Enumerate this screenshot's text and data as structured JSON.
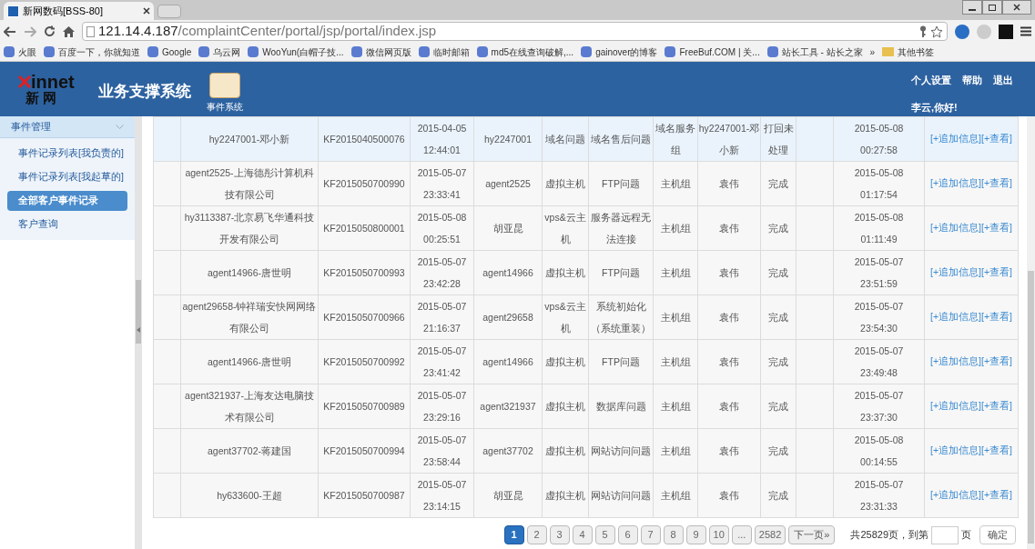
{
  "browser": {
    "tabs": [
      {
        "title": "新网数码[BSS-80]",
        "selected": true
      }
    ],
    "address": {
      "host": "121.14.4.187",
      "path": "/complaintCenter/portal/jsp/portal/index.jsp"
    },
    "bookmarks": [
      {
        "label": "火眼"
      },
      {
        "label": "百度一下，你就知道"
      },
      {
        "label": "Google"
      },
      {
        "label": "乌云网"
      },
      {
        "label": "WooYun(白帽子技..."
      },
      {
        "label": "微信网页版"
      },
      {
        "label": "临时邮箱"
      },
      {
        "label": "md5在线查询破解,..."
      },
      {
        "label": "gainover的博客"
      },
      {
        "label": "FreeBuf.COM | 关..."
      },
      {
        "label": "站长工具 - 站长之家"
      }
    ],
    "more": "»",
    "other_bookmarks": "其他书签"
  },
  "header": {
    "logo_wordmark": "innet",
    "logo_chinese": "新 网",
    "system_title": "业务支撑系统",
    "module": "事件系统",
    "links": [
      "个人设置",
      "帮助",
      "退出"
    ],
    "greeting": "李云,你好!"
  },
  "sidebar": {
    "section": "事件管理",
    "items": [
      {
        "label": "事件记录列表[我负责的]",
        "selected": false
      },
      {
        "label": "事件记录列表[我起草的]",
        "selected": false
      },
      {
        "label": "全部客户事件记录",
        "selected": true
      },
      {
        "label": "客户查询",
        "selected": false
      }
    ]
  },
  "table": {
    "rows": [
      {
        "selected": true,
        "cells": [
          "hy2247001-邓小新",
          "KF2015040500076",
          "2015-04-05 12:44:01",
          "hy2247001",
          "域名问题",
          "域名售后问题",
          "域名服务组",
          "hy2247001-邓小新",
          "打回未处理",
          "2015-05-08 00:27:58"
        ],
        "actions": [
          "[+追加信息]",
          "[+查看]"
        ]
      },
      {
        "selected": false,
        "cells": [
          "agent2525-上海德彤计算机科技有限公司",
          "KF2015050700990",
          "2015-05-07 23:33:41",
          "agent2525",
          "虚拟主机",
          "FTP问题",
          "主机组",
          "袁伟",
          "完成",
          "2015-05-08 01:17:54"
        ],
        "actions": [
          "[+追加信息]",
          "[+查看]"
        ]
      },
      {
        "selected": false,
        "cells": [
          "hy3113387-北京易飞华通科技开发有限公司",
          "KF2015050800001",
          "2015-05-08 00:25:51",
          "胡亚昆",
          "vps&云主机",
          "服务器远程无法连接",
          "主机组",
          "袁伟",
          "完成",
          "2015-05-08 01:11:49"
        ],
        "actions": [
          "[+追加信息]",
          "[+查看]"
        ]
      },
      {
        "selected": false,
        "cells": [
          "agent14966-唐世明",
          "KF2015050700993",
          "2015-05-07 23:42:28",
          "agent14966",
          "虚拟主机",
          "FTP问题",
          "主机组",
          "袁伟",
          "完成",
          "2015-05-07 23:51:59"
        ],
        "actions": [
          "[+追加信息]",
          "[+查看]"
        ]
      },
      {
        "selected": false,
        "cells": [
          "agent29658-钟祥瑞安快网网络有限公司",
          "KF2015050700966",
          "2015-05-07 21:16:37",
          "agent29658",
          "vps&云主机",
          "系统初始化（系统重装）",
          "主机组",
          "袁伟",
          "完成",
          "2015-05-07 23:54:30"
        ],
        "actions": [
          "[+追加信息]",
          "[+查看]"
        ]
      },
      {
        "selected": false,
        "cells": [
          "agent14966-唐世明",
          "KF2015050700992",
          "2015-05-07 23:41:42",
          "agent14966",
          "虚拟主机",
          "FTP问题",
          "主机组",
          "袁伟",
          "完成",
          "2015-05-07 23:49:48"
        ],
        "actions": [
          "[+追加信息]",
          "[+查看]"
        ]
      },
      {
        "selected": false,
        "cells": [
          "agent321937-上海友达电脑技术有限公司",
          "KF2015050700989",
          "2015-05-07 23:29:16",
          "agent321937",
          "虚拟主机",
          "数据库问题",
          "主机组",
          "袁伟",
          "完成",
          "2015-05-07 23:37:30"
        ],
        "actions": [
          "[+追加信息]",
          "[+查看]"
        ]
      },
      {
        "selected": false,
        "cells": [
          "agent37702-蒋建国",
          "KF2015050700994",
          "2015-05-07 23:58:44",
          "agent37702",
          "虚拟主机",
          "网站访问问题",
          "主机组",
          "袁伟",
          "完成",
          "2015-05-08 00:14:55"
        ],
        "actions": [
          "[+追加信息]",
          "[+查看]"
        ]
      },
      {
        "selected": false,
        "cells": [
          "hy633600-王超",
          "KF2015050700987",
          "2015-05-07 23:14:15",
          "胡亚昆",
          "虚拟主机",
          "网站访问问题",
          "主机组",
          "袁伟",
          "完成",
          "2015-05-07 23:31:33"
        ],
        "actions": [
          "[+追加信息]",
          "[+查看]"
        ]
      }
    ]
  },
  "pagination": {
    "pages": [
      {
        "label": "1",
        "selected": true
      },
      {
        "label": "2",
        "selected": false
      },
      {
        "label": "3",
        "selected": false
      },
      {
        "label": "4",
        "selected": false
      },
      {
        "label": "5",
        "selected": false
      },
      {
        "label": "6",
        "selected": false
      },
      {
        "label": "7",
        "selected": false
      },
      {
        "label": "8",
        "selected": false
      },
      {
        "label": "9",
        "selected": false
      },
      {
        "label": "10",
        "selected": false
      },
      {
        "label": "...",
        "selected": false
      },
      {
        "label": "2582",
        "selected": false
      }
    ],
    "next": "下一页»",
    "total": "共25829页，到第",
    "page_unit": "页",
    "confirm": "确定"
  }
}
